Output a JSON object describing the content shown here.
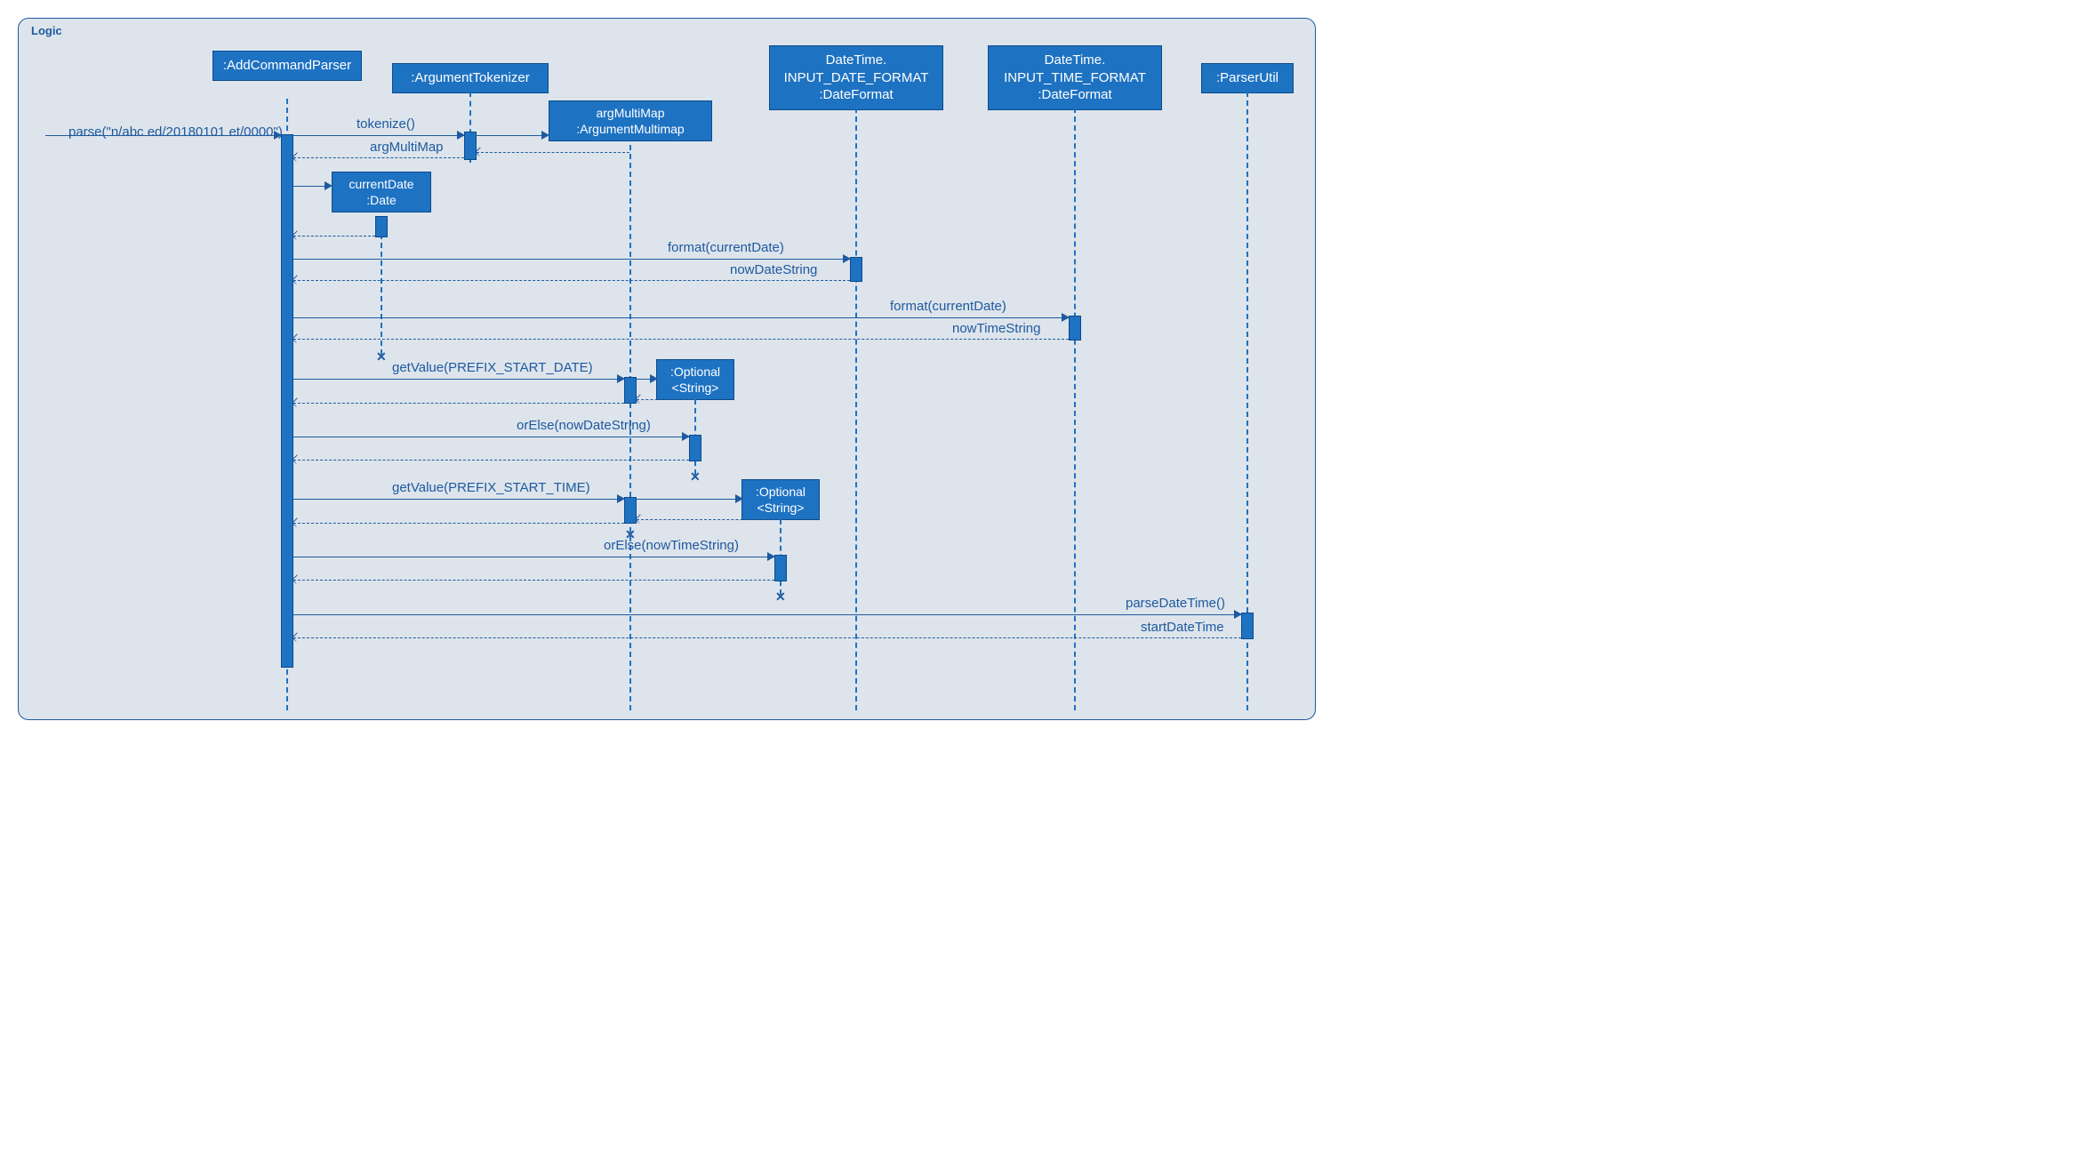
{
  "frame_label": "Logic",
  "lifelines": {
    "addCommandParser": ":AddCommandParser",
    "argumentTokenizer": ":ArgumentTokenizer",
    "argMultiMap": "argMultiMap\n:ArgumentMultimap",
    "inputDateFormat": "DateTime.\nINPUT_DATE_FORMAT\n:DateFormat",
    "inputTimeFormat": "DateTime.\nINPUT_TIME_FORMAT\n:DateFormat",
    "parserUtil": ":ParserUtil",
    "currentDate": "currentDate\n:Date",
    "optional1": ":Optional\n<String>",
    "optional2": ":Optional\n<String>"
  },
  "messages": {
    "parse": "parse(\"n/abc ed/20180101\net/0000\")",
    "tokenize": "tokenize()",
    "argMultiMapReturn": "argMultiMap",
    "formatCurrentDate1": "format(currentDate)",
    "nowDateString": "nowDateString",
    "formatCurrentDate2": "format(currentDate)",
    "nowTimeString": "nowTimeString",
    "getValueStartDate": "getValue(PREFIX_START_DATE)",
    "orElseNowDateString": "orElse(nowDateString)",
    "getValueStartTime": "getValue(PREFIX_START_TIME)",
    "orElseNowTimeString": "orElse(nowTimeString)",
    "parseDateTime": "parseDateTime()",
    "startDateTime": "startDateTime"
  }
}
